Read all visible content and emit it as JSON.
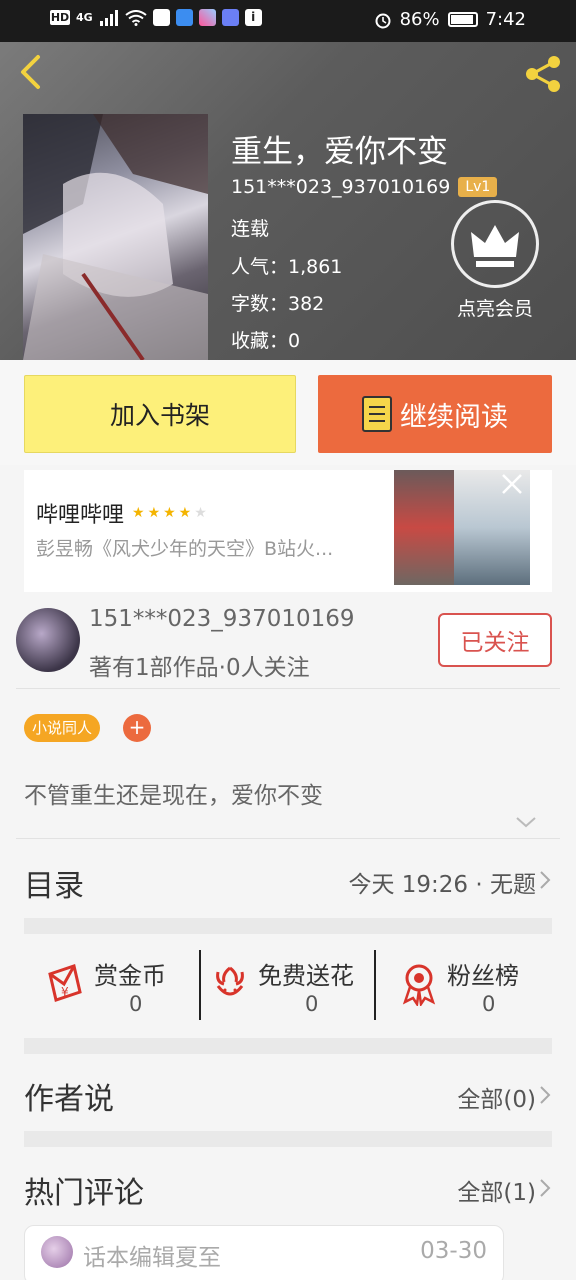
{
  "status_bar": {
    "left_hd": "HD",
    "signal": "4G",
    "battery": "86%",
    "time": "7:42"
  },
  "book": {
    "title": "重生，爱你不变",
    "author": "151***023_937010169",
    "level": "Lv1",
    "status": "连载",
    "popularity": "人气：1,861",
    "word_count": "字数：382",
    "favorites": "收藏：0"
  },
  "vip": {
    "label": "点亮会员"
  },
  "actions": {
    "add_shelf": "加入书架",
    "continue_read": "继续阅读"
  },
  "ad": {
    "title": "哔哩哔哩",
    "rating": 4,
    "description": "彭昱畅《风犬少年的天空》B站火..."
  },
  "author_card": {
    "name": "151***023_937010169",
    "stats": "著有1部作品·0人关注",
    "follow_label": "已关注"
  },
  "tags": {
    "tag1": "小说同人",
    "add": "+"
  },
  "description": "不管重生还是现在，爱你不变",
  "catalog": {
    "label": "目录",
    "latest": "今天 19:26 · 无题"
  },
  "rewards": [
    {
      "label": "赏金币",
      "value": "0"
    },
    {
      "label": "免费送花",
      "value": "0"
    },
    {
      "label": "粉丝榜",
      "value": "0"
    }
  ],
  "author_says": {
    "label": "作者说",
    "all": "全部(0)"
  },
  "hot_comments": {
    "label": "热门评论",
    "all": "全部(1)"
  },
  "comment_preview": {
    "user": "话本编辑夏至",
    "date": "03-30"
  },
  "colors": {
    "accent_orange": "#ec6a3e",
    "shelf_yellow": "#fdf07a",
    "level_gold": "#e8b04a",
    "follow_red": "#d9534f",
    "reward_red": "#d8342b",
    "back_yellow": "#f3d23f"
  },
  "icons": {
    "back": "chevron-left-icon",
    "share": "share-icon",
    "vip": "crown-icon",
    "read": "book-icon",
    "ad_close": "close-icon",
    "reward_coin": "red-envelope-icon",
    "reward_flower": "flower-icon",
    "reward_fans": "ribbon-badge-icon"
  }
}
